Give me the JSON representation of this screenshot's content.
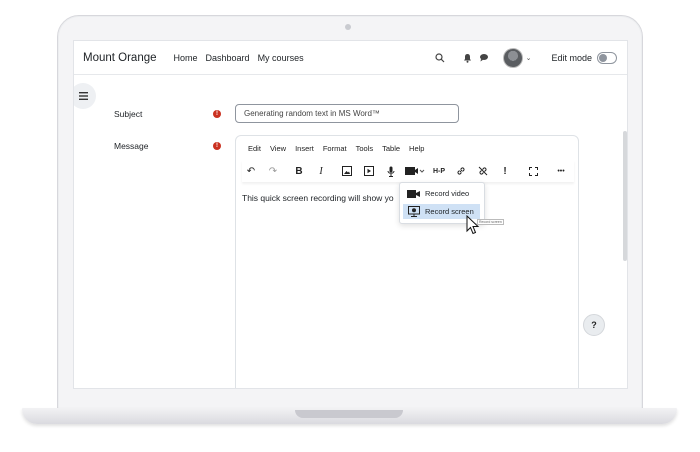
{
  "navbar": {
    "brand": "Mount Orange",
    "links": [
      "Home",
      "Dashboard",
      "My courses"
    ],
    "edit_mode_label": "Edit mode"
  },
  "form": {
    "subject_label": "Subject",
    "subject_value": "Generating random text in MS Word™",
    "message_label": "Message",
    "required_mark": "!"
  },
  "editor": {
    "menu": [
      "Edit",
      "View",
      "Insert",
      "Format",
      "Tools",
      "Table",
      "Help"
    ],
    "toolbar": {
      "undo": "↶",
      "redo": "↷",
      "bold": "B",
      "italic": "I",
      "h5p": "H-P",
      "exclamation": "!",
      "more": "•••"
    },
    "content_text": "This quick screen recording will show yo",
    "dropdown": {
      "items": [
        "Record video",
        "Record screen"
      ],
      "active_index": 1
    },
    "tooltip_text": "Record screen"
  },
  "help_button": "?",
  "colors": {
    "required": "#ca3120",
    "dropdown_active": "#cfe1f5",
    "border": "#8f959e"
  }
}
